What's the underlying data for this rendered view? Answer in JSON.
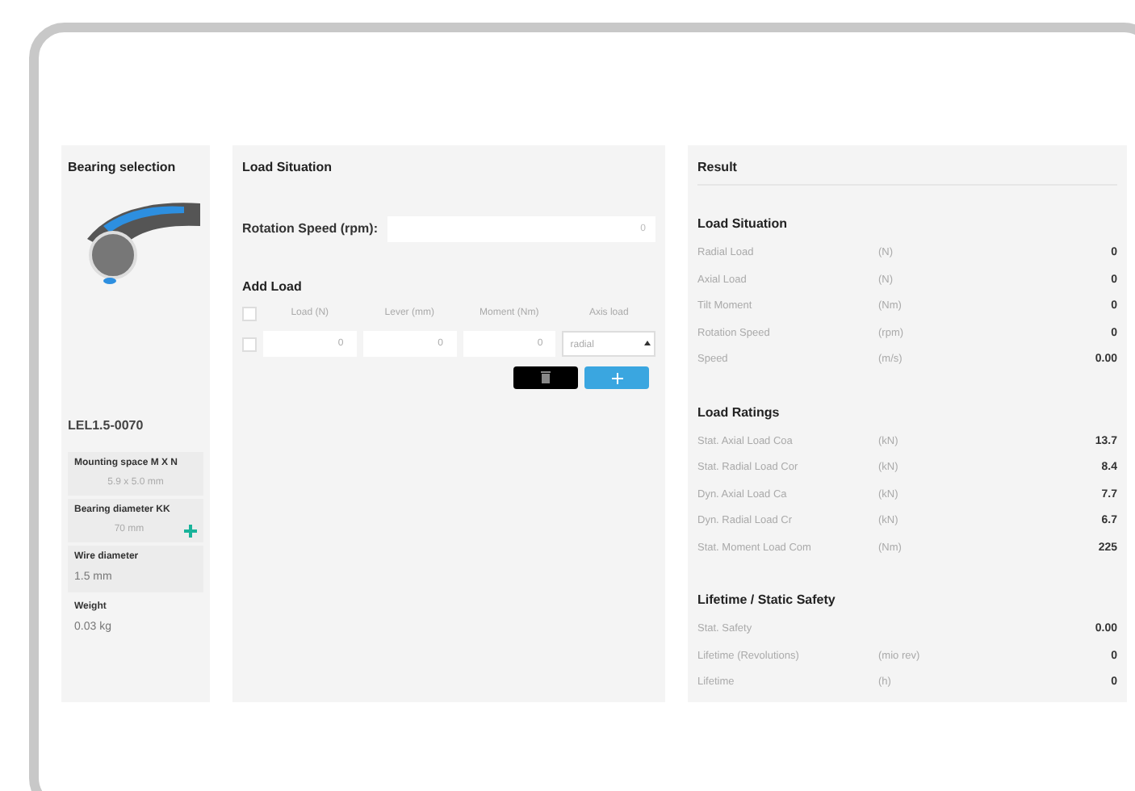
{
  "bearing": {
    "title": "Bearing selection",
    "product": "LEL1.5-0070",
    "specs": [
      {
        "label": "Mounting space M X N",
        "value": "5.9 x 5.0 mm",
        "kind": "boxed"
      },
      {
        "label": "Bearing diameter KK",
        "value": "70 mm",
        "kind": "add"
      },
      {
        "label": "Wire diameter",
        "value": "1.5 mm",
        "kind": "plain"
      },
      {
        "label": "Weight",
        "value": "0.03 kg",
        "kind": "plain"
      }
    ]
  },
  "load": {
    "title": "Load Situation",
    "speed_label": "Rotation Speed (rpm):",
    "speed_value": "0",
    "add_title": "Add Load",
    "header_checked": false,
    "columns": [
      "Load (N)",
      "Lever (mm)",
      "Moment (Nm)",
      "Axis load"
    ],
    "rows": [
      {
        "checked": false,
        "load": "0",
        "lever": "0",
        "moment": "0",
        "axis": "radial"
      }
    ]
  },
  "result": {
    "title": "Result",
    "sections": [
      {
        "title": "Load Situation",
        "rows": [
          {
            "label": "Radial Load",
            "unit": "(N)",
            "value": "0"
          },
          {
            "label": "Axial Load",
            "unit": "(N)",
            "value": "0"
          },
          {
            "label": "Tilt Moment",
            "unit": "(Nm)",
            "value": "0"
          },
          {
            "label": "Rotation Speed",
            "unit": "(rpm)",
            "value": "0"
          },
          {
            "label": "Speed",
            "unit": "(m/s)",
            "value": "0.00"
          }
        ]
      },
      {
        "title": "Load Ratings",
        "rows": [
          {
            "label": "Stat. Axial Load Coa",
            "unit": "(kN)",
            "value": "13.7"
          },
          {
            "label": "Stat. Radial Load Cor",
            "unit": "(kN)",
            "value": "8.4"
          },
          {
            "label": "Dyn. Axial Load Ca",
            "unit": "(kN)",
            "value": "7.7"
          },
          {
            "label": "Dyn. Radial Load Cr",
            "unit": "(kN)",
            "value": "6.7"
          },
          {
            "label": "Stat. Moment Load Com",
            "unit": "(Nm)",
            "value": "225"
          }
        ]
      },
      {
        "title": "Lifetime / Static Safety",
        "rows": [
          {
            "label": "Stat. Safety",
            "unit": "",
            "value": "0.00"
          },
          {
            "label": "Lifetime (Revolutions)",
            "unit": "(mio rev)",
            "value": "0"
          },
          {
            "label": "Lifetime",
            "unit": "(h)",
            "value": "0"
          }
        ]
      }
    ]
  }
}
